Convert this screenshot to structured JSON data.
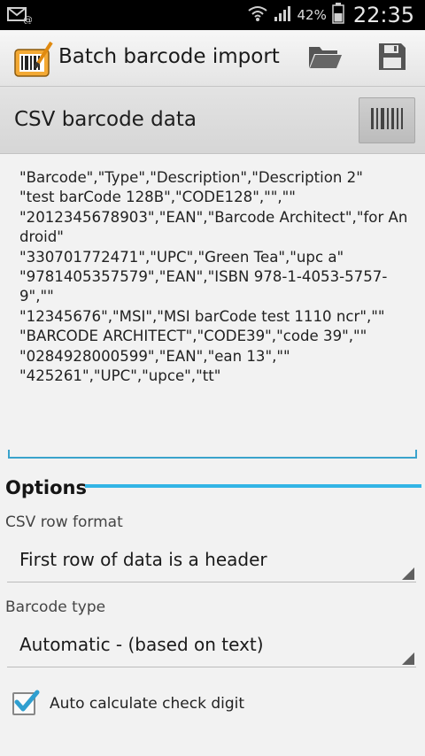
{
  "status_bar": {
    "battery_percent": "42%",
    "time": "22:35",
    "icons": [
      "email-icon",
      "wifi-icon",
      "signal-icon",
      "battery-icon"
    ]
  },
  "action_bar": {
    "title": "Batch barcode import",
    "icons": [
      "app-barcode-icon",
      "folder-open-icon",
      "save-icon"
    ]
  },
  "csv_section": {
    "title": "CSV barcode data",
    "scan_icon": "barcode-scan-icon",
    "text": "\"Barcode\",\"Type\",\"Description\",\"Description 2\"\n\"test barCode 128B\",\"CODE128\",\"\",\"\"\n\"2012345678903\",\"EAN\",\"Barcode Architect\",\"for Android\"\n\"330701772471\",\"UPC\",\"Green Tea\",\"upc a\"\n\"9781405357579\",\"EAN\",\"ISBN 978-1-4053-5757-9\",\"\"\n\"12345676\",\"MSI\",\"MSI barCode test 1110 ncr\",\"\"\n\"BARCODE ARCHITECT\",\"CODE39\",\"code 39\",\"\"\n\"0284928000599\",\"EAN\",\"ean 13\",\"\"\n\"425261\",\"UPC\",\"upce\",\"tt\""
  },
  "options": {
    "title": "Options",
    "row_format_label": "CSV row format",
    "row_format_value": "First row of data is a header",
    "barcode_type_label": "Barcode type",
    "barcode_type_value": "Automatic - (based on text)",
    "check_digit_label": "Auto calculate check digit",
    "check_digit_checked": true
  },
  "colors": {
    "accent": "#33b5e5",
    "check": "#2f9fd0"
  }
}
